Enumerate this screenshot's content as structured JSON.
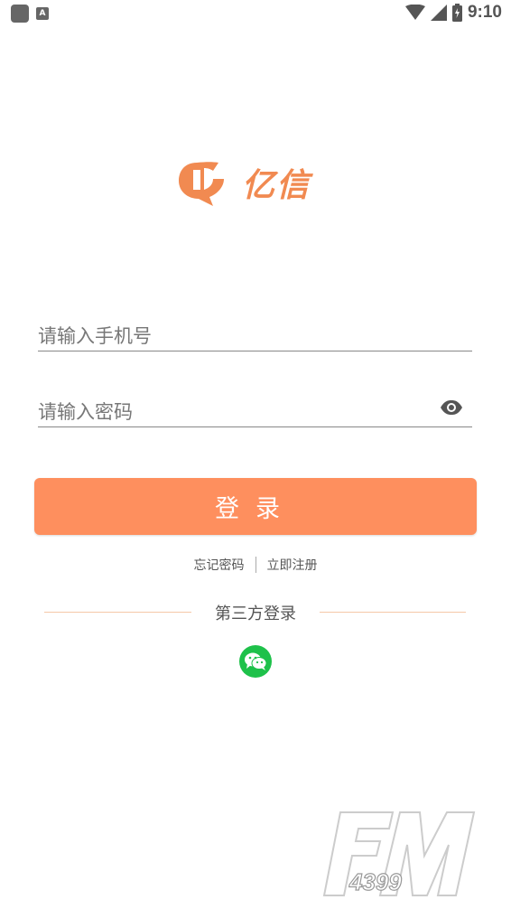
{
  "status_bar": {
    "time": "9:10",
    "notification_icon": "A",
    "icons": [
      "app-icon",
      "notification-a-icon",
      "wifi-icon",
      "signal-icon",
      "battery-icon"
    ]
  },
  "logo": {
    "text": "亿信",
    "color": "#f18a51"
  },
  "form": {
    "phone_placeholder": "请输入手机号",
    "password_placeholder": "请输入密码",
    "eye_icon": "eye-icon"
  },
  "login_button": {
    "label": "登录",
    "color": "#fe8f5e"
  },
  "links": {
    "forgot_password": "忘记密码",
    "register": "立即注册"
  },
  "third_party": {
    "label": "第三方登录",
    "wechat_icon": "wechat-icon",
    "wechat_color": "#1ec14a"
  },
  "watermark": {
    "text": "FM 4399"
  }
}
